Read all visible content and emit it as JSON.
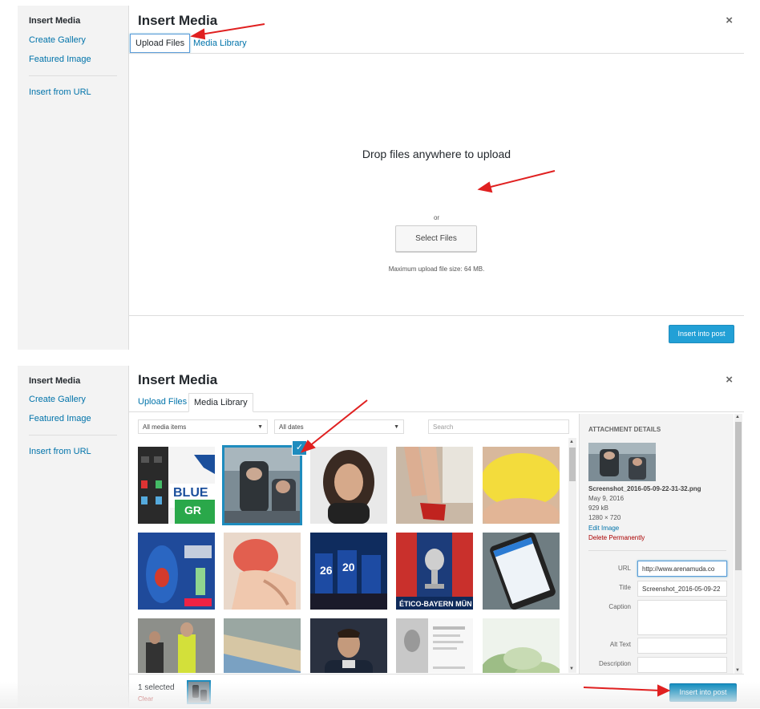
{
  "top_panel": {
    "sidebar": {
      "heading": "Insert Media",
      "items": [
        "Create Gallery",
        "Featured Image",
        "Insert from URL"
      ]
    },
    "title": "Insert Media",
    "close_icon": "×",
    "tabs": [
      "Upload Files",
      "Media Library"
    ],
    "active_tab": "Upload Files",
    "drop_text": "Drop files anywhere to upload",
    "or_text": "or",
    "select_button": "Select Files",
    "max_size": "Maximum upload file size: 64 MB.",
    "insert_button": "Insert into post"
  },
  "bottom_panel": {
    "sidebar": {
      "heading": "Insert Media",
      "items": [
        "Create Gallery",
        "Featured Image",
        "Insert from URL"
      ]
    },
    "title": "Insert Media",
    "close_icon": "×",
    "tabs": [
      "Upload Files",
      "Media Library"
    ],
    "active_tab": "Media Library",
    "filter_type": "All media items",
    "filter_date": "All dates",
    "search_placeholder": "Search",
    "attachment": {
      "header": "ATTACHMENT DETAILS",
      "filename": "Screenshot_2016-05-09-22-31-32.png",
      "date": "May 9, 2016",
      "size": "929 kB",
      "dimensions": "1280 × 720",
      "edit_link": "Edit Image",
      "delete_link": "Delete Permanently",
      "fields": {
        "url_label": "URL",
        "url_value": "http://www.arenamuda.co",
        "title_label": "Title",
        "title_value": "Screenshot_2016-05-09-22",
        "caption_label": "Caption",
        "alt_label": "Alt Text",
        "description_label": "Description"
      }
    },
    "selected_count": "1 selected",
    "clear_link": "Clear",
    "insert_button": "Insert into post",
    "check_icon": "✓"
  },
  "colors": {
    "accent": "#0073aa",
    "primary_button": "#0085ba",
    "selection": "#1e8cbe",
    "annotation_arrow": "#e02020"
  }
}
